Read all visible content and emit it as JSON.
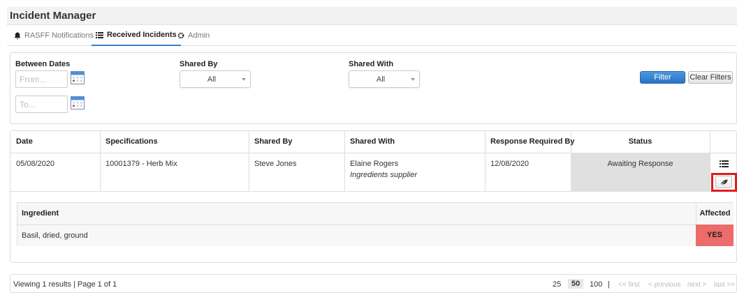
{
  "app": {
    "title": "Incident Manager"
  },
  "tabs": [
    {
      "label": "RASFF Notifications",
      "icon": "bell-icon",
      "active": false
    },
    {
      "label": "Received Incidents",
      "icon": "list-icon",
      "active": true
    },
    {
      "label": "Admin",
      "icon": "gear-icon",
      "active": false
    }
  ],
  "filters": {
    "between_dates_label": "Between Dates",
    "from_placeholder": "From...",
    "to_placeholder": "To...",
    "shared_by_label": "Shared By",
    "shared_by_value": "All",
    "shared_with_label": "Shared With",
    "shared_with_value": "All",
    "filter_button": "Filter",
    "clear_button": "Clear Filters"
  },
  "table": {
    "headers": [
      "Date",
      "Specifications",
      "Shared By",
      "Shared With",
      "Response Required By",
      "Status"
    ],
    "rows": [
      {
        "date": "05/08/2020",
        "specification": "10001379 - Herb Mix",
        "shared_by": "Steve Jones",
        "shared_with": "Elaine Rogers",
        "shared_with_role": "Ingredients supplier",
        "response_required_by": "12/08/2020",
        "status": "Awaiting Response",
        "actions": [
          "list-icon",
          "leaf-icon"
        ]
      }
    ],
    "sub_table": {
      "headers": [
        "Ingredient",
        "Affected"
      ],
      "rows": [
        {
          "ingredient": "Basil, dried, ground",
          "affected": "YES"
        }
      ]
    }
  },
  "pagination": {
    "info": "Viewing 1 results | Page 1 of 1",
    "sizes": [
      "25",
      "50",
      "100"
    ],
    "selected_size": "50",
    "separator": "|",
    "first": "<< first",
    "previous": "< previous",
    "next": "next >",
    "last": "last >>"
  },
  "colors": {
    "accent": "#2a73c4",
    "affected_yes": "#ec6b6b",
    "status_bg": "#e0e0e0",
    "highlight": "#e21a1a"
  }
}
